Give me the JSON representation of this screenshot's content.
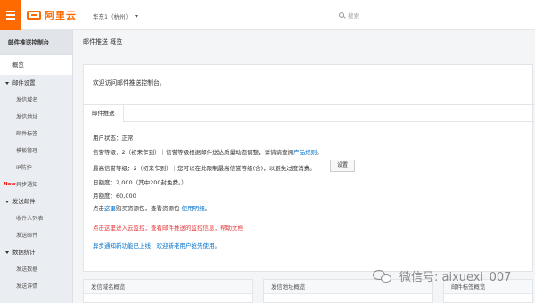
{
  "header": {
    "logo_text": "阿里云",
    "region": "华东1（杭州）",
    "search_placeholder": "搜索"
  },
  "sidebar": {
    "title": "邮件推送控制台",
    "overview": "概览",
    "groups": [
      {
        "label": "邮件设置",
        "items": [
          "发信域名",
          "发信地址",
          "邮件标签",
          "模板管理",
          "IP防护",
          "异步通知"
        ]
      },
      {
        "label": "发送邮件",
        "items": [
          "收件人列表",
          "发送邮件"
        ]
      },
      {
        "label": "数据统计",
        "items": [
          "发送数据",
          "发送详情"
        ]
      }
    ],
    "new_badge": "New"
  },
  "main": {
    "breadcrumb": "邮件推送 概览",
    "welcome": "欢迎访问邮件推送控制台。",
    "tab": "邮件推送",
    "user_status": "用户状态：正常",
    "credit_level_prefix": "信誉等级：2（初来乍到）｜信誉等级根据邮件送达质量动态调整，详情请查阅",
    "credit_rule_link": "产品规则",
    "credit_level_suffix": "。",
    "max_level": "最高信誉等级：2（初来乍到）｜您可以在此限制最高信誉等级(含)，以避免过度消费。",
    "set_button": "设置",
    "daily_quota": "日额度：2,000（其中200封免费。）",
    "monthly_quota": "月额度：60,000",
    "purchase_prefix": "点击",
    "purchase_link_here": "这里",
    "purchase_middle": "购买资源包，查看资源包 ",
    "purchase_link_doc": "使用明细",
    "purchase_suffix": "。",
    "monitor_text": "点击这里进入云监控，查看邮件推送的监控信息，帮助文档",
    "async_notice": "异步通知新功能已上线，欢迎新老用户抢先使用。"
  },
  "panels": [
    {
      "title": "发信域名概览"
    },
    {
      "title": "发信地址概览"
    },
    {
      "title": "邮件标签概览"
    }
  ],
  "watermark": "微信号: aixuexi_007",
  "colors": {
    "brand": "#ff6a00",
    "link": "#0070cc",
    "alert": "#e4393c"
  }
}
